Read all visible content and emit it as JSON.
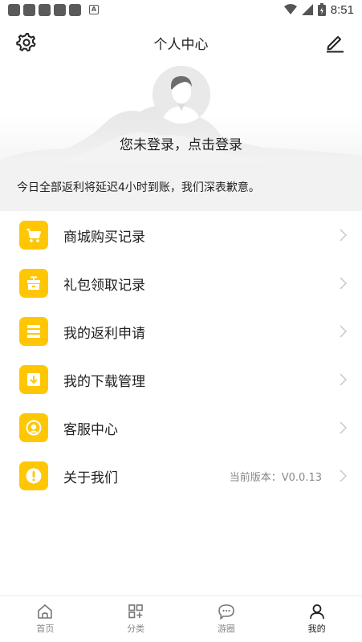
{
  "status_bar": {
    "time": "8:51"
  },
  "header": {
    "title": "个人中心",
    "login_prompt": "您未登录，点击登录"
  },
  "notice": {
    "text": "今日全部返利将延迟4小时到账，我们深表歉意。"
  },
  "menu": {
    "items": [
      {
        "label": "商城购买记录",
        "icon": "cart-icon"
      },
      {
        "label": "礼包领取记录",
        "icon": "gift-icon"
      },
      {
        "label": "我的返利申请",
        "icon": "rebate-icon"
      },
      {
        "label": "我的下载管理",
        "icon": "download-icon"
      },
      {
        "label": "客服中心",
        "icon": "headset-icon"
      },
      {
        "label": "关于我们",
        "icon": "info-icon",
        "extra": "当前版本：V0.0.13"
      }
    ]
  },
  "tabbar": {
    "tabs": [
      {
        "label": "首页"
      },
      {
        "label": "分类"
      },
      {
        "label": "游圈"
      },
      {
        "label": "我的"
      }
    ],
    "active": "我的"
  },
  "colors": {
    "accent": "#ffc703",
    "notice_bg": "#f2f2f2"
  }
}
